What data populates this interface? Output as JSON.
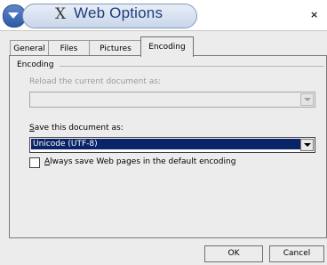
{
  "window": {
    "title": "Web Options",
    "logo_glyph": "X",
    "close_glyph": "×"
  },
  "tabs": [
    {
      "label": "General"
    },
    {
      "label": "Files"
    },
    {
      "label": "Pictures"
    },
    {
      "label": "Encoding",
      "active": true
    }
  ],
  "encoding": {
    "group_label": "Encoding",
    "reload_label": "Reload the current document as:",
    "reload_value": "",
    "save_label_prefix": "S",
    "save_label_rest": "ave this document as:",
    "save_value": "Unicode (UTF-8)",
    "always_save_prefix": "A",
    "always_save_rest": "lways save Web pages in the default encoding",
    "always_save_checked": false
  },
  "buttons": {
    "ok": "OK",
    "cancel": "Cancel"
  },
  "colors": {
    "selection": "#0a246a",
    "title_text": "#1e3d7a"
  }
}
